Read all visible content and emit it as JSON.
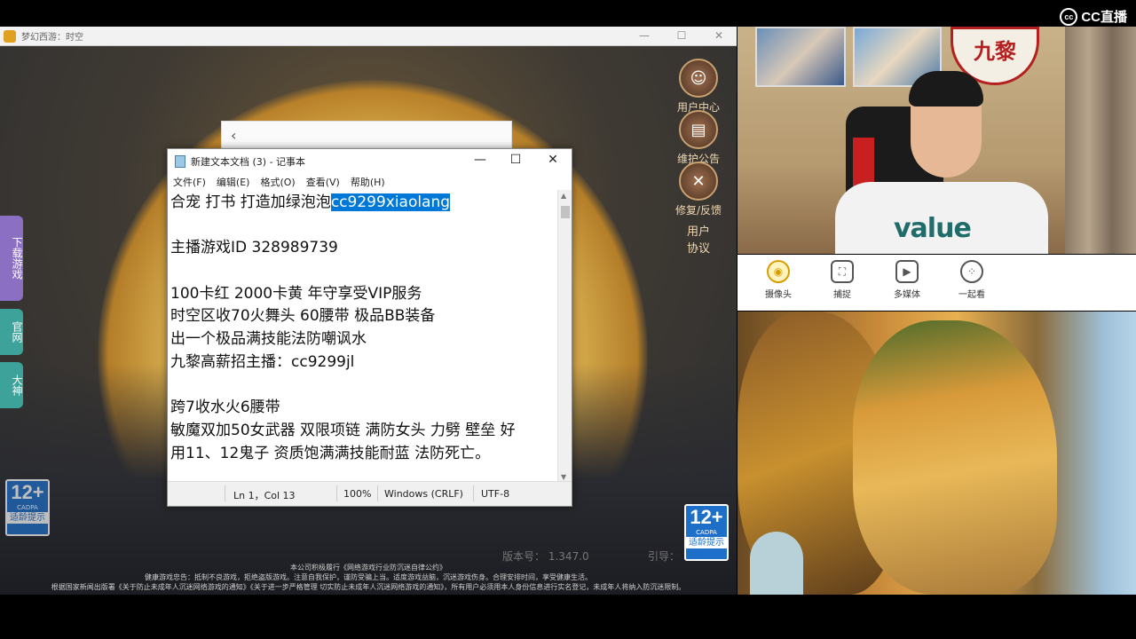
{
  "platform": {
    "brand": "CC直播"
  },
  "game_window": {
    "title": "梦幻西游：时空",
    "controls": {
      "minimize": "—",
      "maximize": "☐",
      "close": "✕"
    },
    "side_tabs": [
      "下载游戏",
      "官网",
      "大神"
    ],
    "right_menu": [
      {
        "label": "用户中心",
        "icon": "user-icon"
      },
      {
        "label": "维护公告",
        "icon": "notice-icon"
      },
      {
        "label": "修复/反馈",
        "icon": "repair-icon"
      },
      {
        "label": "用户协议",
        "icon": "agreement-icon"
      }
    ],
    "age_badge": {
      "number": "12+",
      "org": "CADPA",
      "tip": "适龄提示"
    },
    "version_label": "版本号：",
    "version_value": "1.347.0",
    "guide_label": "引导：",
    "footer": [
      "本公司积极履行《网络游戏行业防沉迷自律公约》",
      "健康游戏忠告：抵制不良游戏，拒绝盗版游戏。注意自我保护，谨防受骗上当。适度游戏益脑，沉迷游戏伤身。合理安排时间，享受健康生活。",
      "根据国家新闻出版署《关于防止未成年人沉迷网络游戏的通知》《关于进一步严格管理 切实防止未成年人沉迷网络游戏的通知》，所有用户必须用本人身份信息进行实名登记，未成年人将纳入防沉迷限制。"
    ]
  },
  "notepad": {
    "title": "新建文本文档 (3) - 记事本",
    "controls": {
      "minimize": "—",
      "maximize": "☐",
      "close": "✕"
    },
    "menu": [
      "文件(F)",
      "编辑(E)",
      "格式(O)",
      "查看(V)",
      "帮助(H)"
    ],
    "line1_prefix": "合宠 打书 打造加绿泡泡",
    "line1_selected": "cc9299xiaolang",
    "lines": [
      "",
      "主播游戏ID 328989739",
      "",
      "100卡红  2000卡黄 年守享受VIP服务",
      "时空区收70火舞头 60腰带 极品BB装备",
      "出一个极品满技能法防嘲讽水",
      "九黎高薪招主播：cc9299jl",
      "",
      "跨7收水火6腰带",
      "敏魔双加50女武器 双限项链 满防女头 力劈 壁垒 好",
      "用11、12鬼子 资质饱满满技能耐蓝 法防死亡。"
    ],
    "status": {
      "position": "Ln 1，Col 13",
      "zoom": "100%",
      "line_ending": "Windows (CRLF)",
      "encoding": "UTF-8"
    }
  },
  "webcam": {
    "shirt_text": "value",
    "drum_text": "九黎"
  },
  "controls_bar": [
    {
      "label": "摄像头",
      "icon": "camera-icon",
      "active": true
    },
    {
      "label": "捕捉",
      "icon": "capture-icon",
      "active": false
    },
    {
      "label": "多媒体",
      "icon": "media-play-icon",
      "active": false
    },
    {
      "label": "一起看",
      "icon": "watch-together-icon",
      "active": false
    }
  ]
}
